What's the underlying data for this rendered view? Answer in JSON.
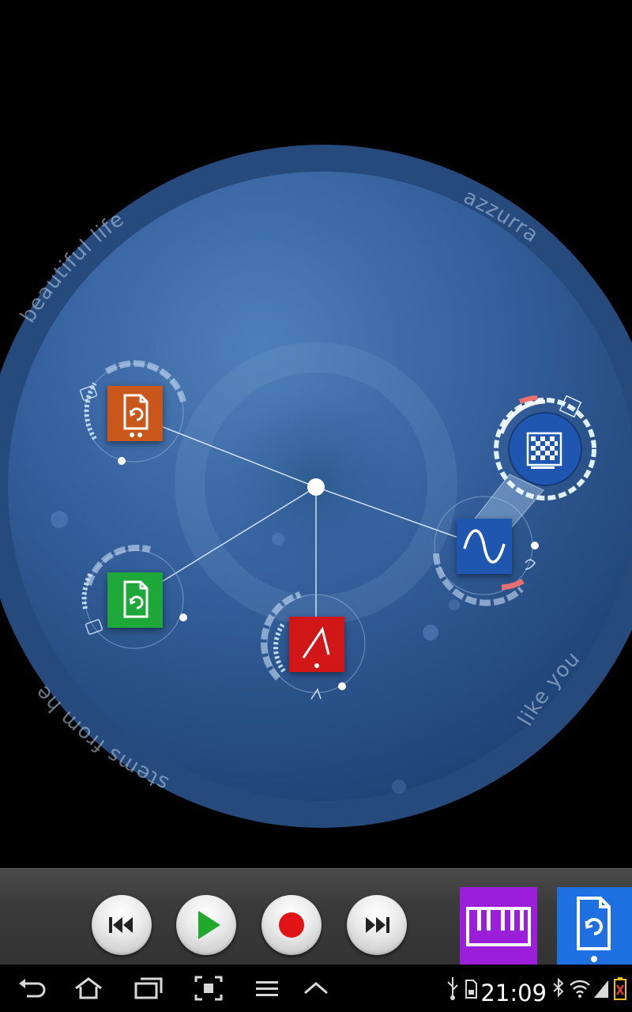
{
  "stage": {
    "rim_labels": {
      "beautiful_life": "beautiful life",
      "azzurra": "azzurra",
      "like_you": "like you",
      "stems_from_hell": "stems from hell"
    }
  },
  "modules": [
    {
      "name": "sample-player-module",
      "icon": "file-loop-icon",
      "color": "#c9561a"
    },
    {
      "name": "loop-player-module",
      "icon": "file-loop-icon",
      "color": "#1fa83a"
    },
    {
      "name": "envelope-module",
      "icon": "envelope-icon",
      "color": "#d01616"
    },
    {
      "name": "oscillator-module",
      "icon": "sine-wave-icon",
      "color": "#1f56b0"
    },
    {
      "name": "noise-module",
      "icon": "noise-grid-icon",
      "color": "#1f56b0"
    }
  ],
  "transport": {
    "buttons": [
      {
        "name": "rewind-button",
        "icon": "skip-back-icon"
      },
      {
        "name": "play-button",
        "icon": "play-icon"
      },
      {
        "name": "record-button",
        "icon": "record-icon"
      },
      {
        "name": "forward-button",
        "icon": "skip-forward-icon"
      }
    ],
    "colors": {
      "play": "#22a82c",
      "record": "#e01414"
    }
  },
  "palette": [
    {
      "name": "keyboard-palette-item",
      "icon": "piano-keys-icon",
      "color": "#9b1fd8"
    },
    {
      "name": "loop-palette-item",
      "icon": "file-loop-icon",
      "color": "#1e6fe0"
    }
  ],
  "status_bar": {
    "time": "21:09",
    "icons": [
      "back-icon",
      "home-icon",
      "recent-apps-icon",
      "screenshot-icon",
      "menu-icon",
      "up-chevron-icon",
      "usb-icon",
      "sd-card-icon",
      "bluetooth-icon",
      "wifi-icon",
      "signal-icon",
      "battery-icon"
    ],
    "battery_color": "#e8c21a"
  }
}
